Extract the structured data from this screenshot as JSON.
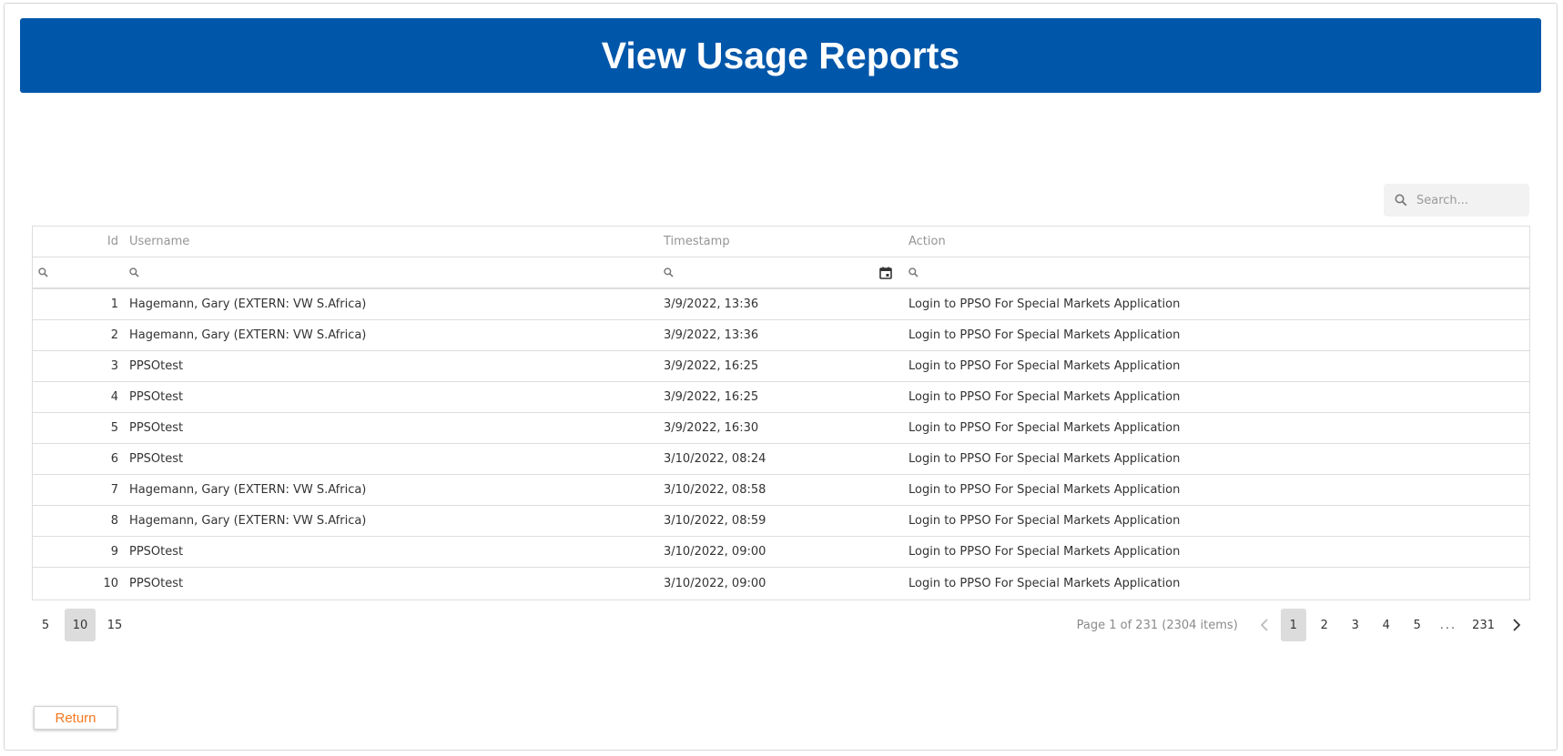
{
  "header": {
    "title": "View Usage Reports"
  },
  "search": {
    "placeholder": "Search..."
  },
  "grid": {
    "columns": {
      "id": "Id",
      "username": "Username",
      "timestamp": "Timestamp",
      "action": "Action"
    },
    "rows": [
      {
        "id": "1",
        "username": "Hagemann, Gary (EXTERN: VW S.Africa)",
        "timestamp": "3/9/2022, 13:36",
        "action": "Login to PPSO For Special Markets Application"
      },
      {
        "id": "2",
        "username": "Hagemann, Gary (EXTERN: VW S.Africa)",
        "timestamp": "3/9/2022, 13:36",
        "action": "Login to PPSO For Special Markets Application"
      },
      {
        "id": "3",
        "username": "PPSOtest",
        "timestamp": "3/9/2022, 16:25",
        "action": "Login to PPSO For Special Markets Application"
      },
      {
        "id": "4",
        "username": "PPSOtest",
        "timestamp": "3/9/2022, 16:25",
        "action": "Login to PPSO For Special Markets Application"
      },
      {
        "id": "5",
        "username": "PPSOtest",
        "timestamp": "3/9/2022, 16:30",
        "action": "Login to PPSO For Special Markets Application"
      },
      {
        "id": "6",
        "username": "PPSOtest",
        "timestamp": "3/10/2022, 08:24",
        "action": "Login to PPSO For Special Markets Application"
      },
      {
        "id": "7",
        "username": "Hagemann, Gary (EXTERN: VW S.Africa)",
        "timestamp": "3/10/2022, 08:58",
        "action": "Login to PPSO For Special Markets Application"
      },
      {
        "id": "8",
        "username": "Hagemann, Gary (EXTERN: VW S.Africa)",
        "timestamp": "3/10/2022, 08:59",
        "action": "Login to PPSO For Special Markets Application"
      },
      {
        "id": "9",
        "username": "PPSOtest",
        "timestamp": "3/10/2022, 09:00",
        "action": "Login to PPSO For Special Markets Application"
      },
      {
        "id": "10",
        "username": "PPSOtest",
        "timestamp": "3/10/2022, 09:00",
        "action": "Login to PPSO For Special Markets Application"
      }
    ]
  },
  "pager": {
    "page_sizes": [
      "5",
      "10",
      "15"
    ],
    "selected_size": "10",
    "info": "Page 1 of 231 (2304 items)",
    "pages": [
      "1",
      "2",
      "3",
      "4",
      "5"
    ],
    "ellipsis": "...",
    "last_page": "231",
    "current_page": "1"
  },
  "footer": {
    "return_label": "Return"
  },
  "colors": {
    "header_bg": "#0057aa",
    "return_text": "#f5781e",
    "active_page_bg": "#dcdcdc"
  },
  "icons": {
    "search": "search-icon",
    "calendar": "calendar-icon",
    "prev": "chevron-left-icon",
    "next": "chevron-right-icon"
  }
}
